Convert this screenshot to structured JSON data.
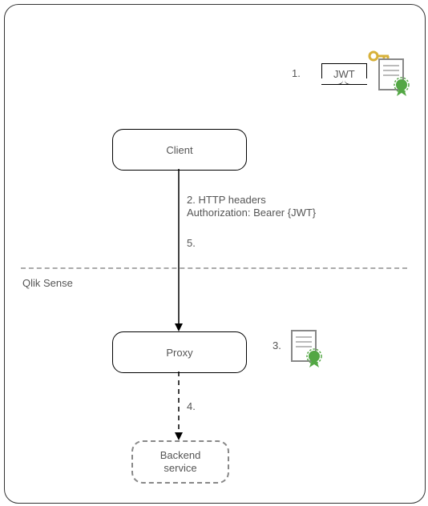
{
  "nodes": {
    "client": "Client",
    "proxy": "Proxy",
    "backend_l1": "Backend",
    "backend_l2": "service",
    "jwt": "JWT"
  },
  "labels": {
    "n1": "1.",
    "n2_l1": "2. HTTP headers",
    "n2_l2": "Authorization: Bearer {JWT}",
    "n3": "3.",
    "n4": "4.",
    "n5": "5.",
    "qlik": "Qlik Sense"
  }
}
